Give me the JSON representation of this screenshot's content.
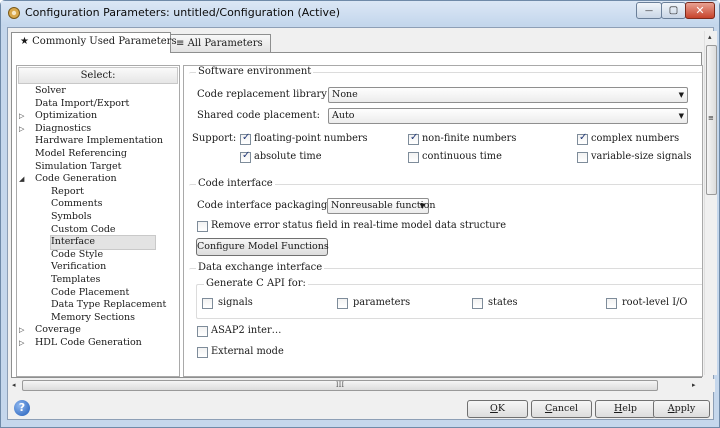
{
  "window": {
    "title": "Configuration Parameters: untitled/Configuration (Active)",
    "minimize_symbol": "—",
    "maximize_symbol": "▢",
    "close_symbol": "✕"
  },
  "tabs": [
    {
      "icon": "★",
      "label": "Commonly Used Parameters",
      "active": true
    },
    {
      "icon": "≡",
      "label": "All Parameters",
      "active": false
    }
  ],
  "tree": {
    "header": "Select:",
    "items": [
      {
        "label": "Solver",
        "level": 0,
        "toggle": ""
      },
      {
        "label": "Data Import/Export",
        "level": 0,
        "toggle": ""
      },
      {
        "label": "Optimization",
        "level": 0,
        "toggle": "▷"
      },
      {
        "label": "Diagnostics",
        "level": 0,
        "toggle": "▷"
      },
      {
        "label": "Hardware Implementation",
        "level": 0,
        "toggle": ""
      },
      {
        "label": "Model Referencing",
        "level": 0,
        "toggle": ""
      },
      {
        "label": "Simulation Target",
        "level": 0,
        "toggle": ""
      },
      {
        "label": "Code Generation",
        "level": 0,
        "toggle": "◢"
      },
      {
        "label": "Report",
        "level": 1,
        "toggle": ""
      },
      {
        "label": "Comments",
        "level": 1,
        "toggle": ""
      },
      {
        "label": "Symbols",
        "level": 1,
        "toggle": ""
      },
      {
        "label": "Custom Code",
        "level": 1,
        "toggle": ""
      },
      {
        "label": "Interface",
        "level": 1,
        "toggle": "",
        "selected": true
      },
      {
        "label": "Code Style",
        "level": 1,
        "toggle": ""
      },
      {
        "label": "Verification",
        "level": 1,
        "toggle": ""
      },
      {
        "label": "Templates",
        "level": 1,
        "toggle": ""
      },
      {
        "label": "Code Placement",
        "level": 1,
        "toggle": ""
      },
      {
        "label": "Data Type Replacement",
        "level": 1,
        "toggle": ""
      },
      {
        "label": "Memory Sections",
        "level": 1,
        "toggle": ""
      },
      {
        "label": "Coverage",
        "level": 0,
        "toggle": "▷"
      },
      {
        "label": "HDL Code Generation",
        "level": 0,
        "toggle": "▷"
      }
    ]
  },
  "software_env": {
    "title": "Software environment",
    "code_replacement_label": "Code replacement library:",
    "code_replacement_value": "None",
    "shared_code_label": "Shared code placement:",
    "shared_code_value": "Auto",
    "support_label": "Support:",
    "support": [
      {
        "label": "floating-point numbers",
        "checked": true
      },
      {
        "label": "non-finite numbers",
        "checked": true
      },
      {
        "label": "complex numbers",
        "checked": true
      },
      {
        "label": "absolute time",
        "checked": true
      },
      {
        "label": "continuous time",
        "checked": false
      },
      {
        "label": "variable-size signals",
        "checked": false
      }
    ]
  },
  "code_interface": {
    "title": "Code interface",
    "packaging_label": "Code interface packaging:",
    "packaging_value": "Nonreusable function",
    "remove_error_label": "Remove error status field in real-time model data structure",
    "remove_error_checked": false,
    "configure_button": "Configure Model Functions"
  },
  "data_exchange": {
    "title": "Data exchange interface",
    "c_api_title": "Generate C API for:",
    "c_api": [
      {
        "label": "signals",
        "checked": false
      },
      {
        "label": "parameters",
        "checked": false
      },
      {
        "label": "states",
        "checked": false
      },
      {
        "label": "root-level I/O",
        "checked": false
      }
    ],
    "asap2_label": "ASAP2 inter…",
    "asap2_checked": false,
    "external_mode_label": "External mode",
    "external_mode_checked": false
  },
  "scroll": {
    "hthumb_grip": "III",
    "left_arrow": "◂",
    "right_arrow": "▸",
    "up_arrow": "▴",
    "down_arrow": "▾"
  },
  "footer": {
    "help_icon_glyph": "?",
    "ok_mnemonic": "O",
    "ok_rest": "K",
    "cancel_mnemonic": "C",
    "cancel_rest": "ancel",
    "help_mnemonic": "H",
    "help_rest": "elp",
    "apply_mnemonic": "A",
    "apply_rest": "pply"
  }
}
